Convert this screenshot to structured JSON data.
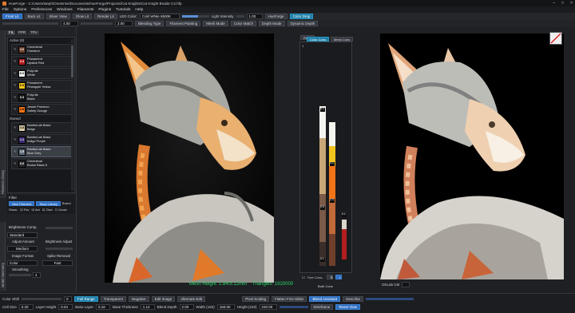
{
  "app": {
    "title": "HueForge - C:/Users/steph/OneDrive/Documents/HueForge/Projects/Cat Knights/Cat Knight Braids C3.hfp"
  },
  "menu": [
    "File",
    "Options",
    "Preferences",
    "Windows",
    "Filaments",
    "Plugins",
    "Tutorials",
    "Help"
  ],
  "toolbar": {
    "view_buttons": [
      "Front Lit",
      "Back Lit",
      "Sliver View",
      "Glow Lit",
      "Render Lit"
    ],
    "led_label": "LED Color:",
    "led_value": "Cold White 6500K",
    "light_label": "Light Intensity",
    "light_value": "1.00",
    "light_fraction": 0.6,
    "hueforge_btn": "HueForge",
    "color_drop_btn": "Color Drop",
    "field1": "4.00",
    "field2": "2.00",
    "blending_type": "Blending Type",
    "filament_painting": "Filament Painting",
    "mesh_mode": "Mesh Mode",
    "color_match": "Color Match",
    "depth_mode": "Depth Mode",
    "dynamic_depth": "Dynamic Depth"
  },
  "left_panel": {
    "tabs": [
      "FIL",
      "PPR",
      "TPU"
    ],
    "active_group": "Active (8)",
    "owned_group": "Owned",
    "filaments_active": [
      {
        "num": "4.0",
        "brand": "Chromimal",
        "name": "Chestnut",
        "color": "#6f3f2c"
      },
      {
        "num": "2.4",
        "brand": "Prusament",
        "name": "Lipstick Red",
        "color": "#b21f1f"
      },
      {
        "num": "6.0",
        "brand": "PolyLite",
        "name": "White",
        "color": "#f3f3ef"
      },
      {
        "num": "0.9",
        "brand": "Prusament",
        "name": "Pineapple Yellow",
        "color": "#f2c41e"
      },
      {
        "num": "0.3",
        "brand": "PolyLite",
        "name": "Black",
        "color": "#181818"
      },
      {
        "num": "2.8",
        "brand": "Jessie Premium",
        "name": "Safety Orange",
        "color": "#f27418"
      }
    ],
    "filaments_owned": [
      {
        "num": "3.8",
        "brand": "BambuLab Basic",
        "name": "Beige",
        "color": "#d9c9a7"
      },
      {
        "num": "1.1",
        "brand": "BambuLab Basic",
        "name": "Indigo Purple",
        "color": "#3d2c73"
      },
      {
        "num": "1.5",
        "brand": "BambuLab Basic",
        "name": "Blue Grey",
        "color": "#5f6b78"
      },
      {
        "num": "6.0",
        "brand": "Chromimal",
        "name": "Bruise Black 6",
        "color": "#2a2a2e"
      }
    ],
    "filter_label": "Filter",
    "new_filament": "New Filament",
    "save_library": "Save Library",
    "brand": "Brand",
    "show_label": "Show:",
    "show_fav": "Fav",
    "show_act": "Act",
    "show_own": "Own",
    "show_unow": "Unow",
    "vtab_top": "Filament Library",
    "vtab_bottom": "Model Geometry",
    "brightness_comp": "Brightness Comp",
    "standard": "Standard",
    "adjust_amount": "Adjust Amount",
    "brightness_adjust": "Brightness Adjust",
    "medium": "Medium",
    "image_format": "Image Format",
    "spike_removal": "Spike Removal",
    "color": "Color",
    "fast": "Fast",
    "smoothing": "Smoothing",
    "smoothing_val": "4"
  },
  "mid_panel": {
    "reset": "Reset",
    "color_cons": "Color Cons",
    "mesh_cons": "Mesh Cons",
    "tree_cons": "Tree Cons...",
    "both_cons": "Both Cons",
    "layer_index": "1",
    "swatch_labels": [
      "8.2",
      "4.1",
      "2.4",
      "0.9",
      "0.1",
      "0.1"
    ]
  },
  "right_panel": {
    "oklab": "OKLab CM"
  },
  "mesh_info": {
    "mesh_height": "Mesh Height: 1.84/3.12mm",
    "triangles": "Triangles: 1920000"
  },
  "status": {
    "color_shift": "Color Shift",
    "color_shift_val": "0",
    "full_range": "Full Range",
    "transparent": "Transparent",
    "negative": "Negative",
    "edit_image": "Edit Image",
    "alternate_edit": "Alternate Edit",
    "pixel_scaling": "Pixel Scaling",
    "flatten_first": "Flatten First Slider",
    "blend_assistant": "Blend Assistant",
    "describe": "Describe",
    "cell_size": "Cell Size",
    "cell_size_val": "0.20",
    "layer_height": "Layer Height",
    "layer_height_val": "0.04",
    "base_layer": "Base Layer",
    "base_layer_val": "0.16",
    "base_thickness": "Base Thickness",
    "base_thickness_val": "1.12",
    "blend_depth": "Blend Depth",
    "blend_depth_val": "2.00",
    "width": "Width (160)",
    "width_val": "160.00",
    "height": "Height (240)",
    "height_val": "240.00",
    "wireframe": "Wireframe",
    "reset_view": "Reset View"
  },
  "colors": {
    "accent_blue": "#2f6fc2",
    "mesh_green": "#2ed66b"
  }
}
